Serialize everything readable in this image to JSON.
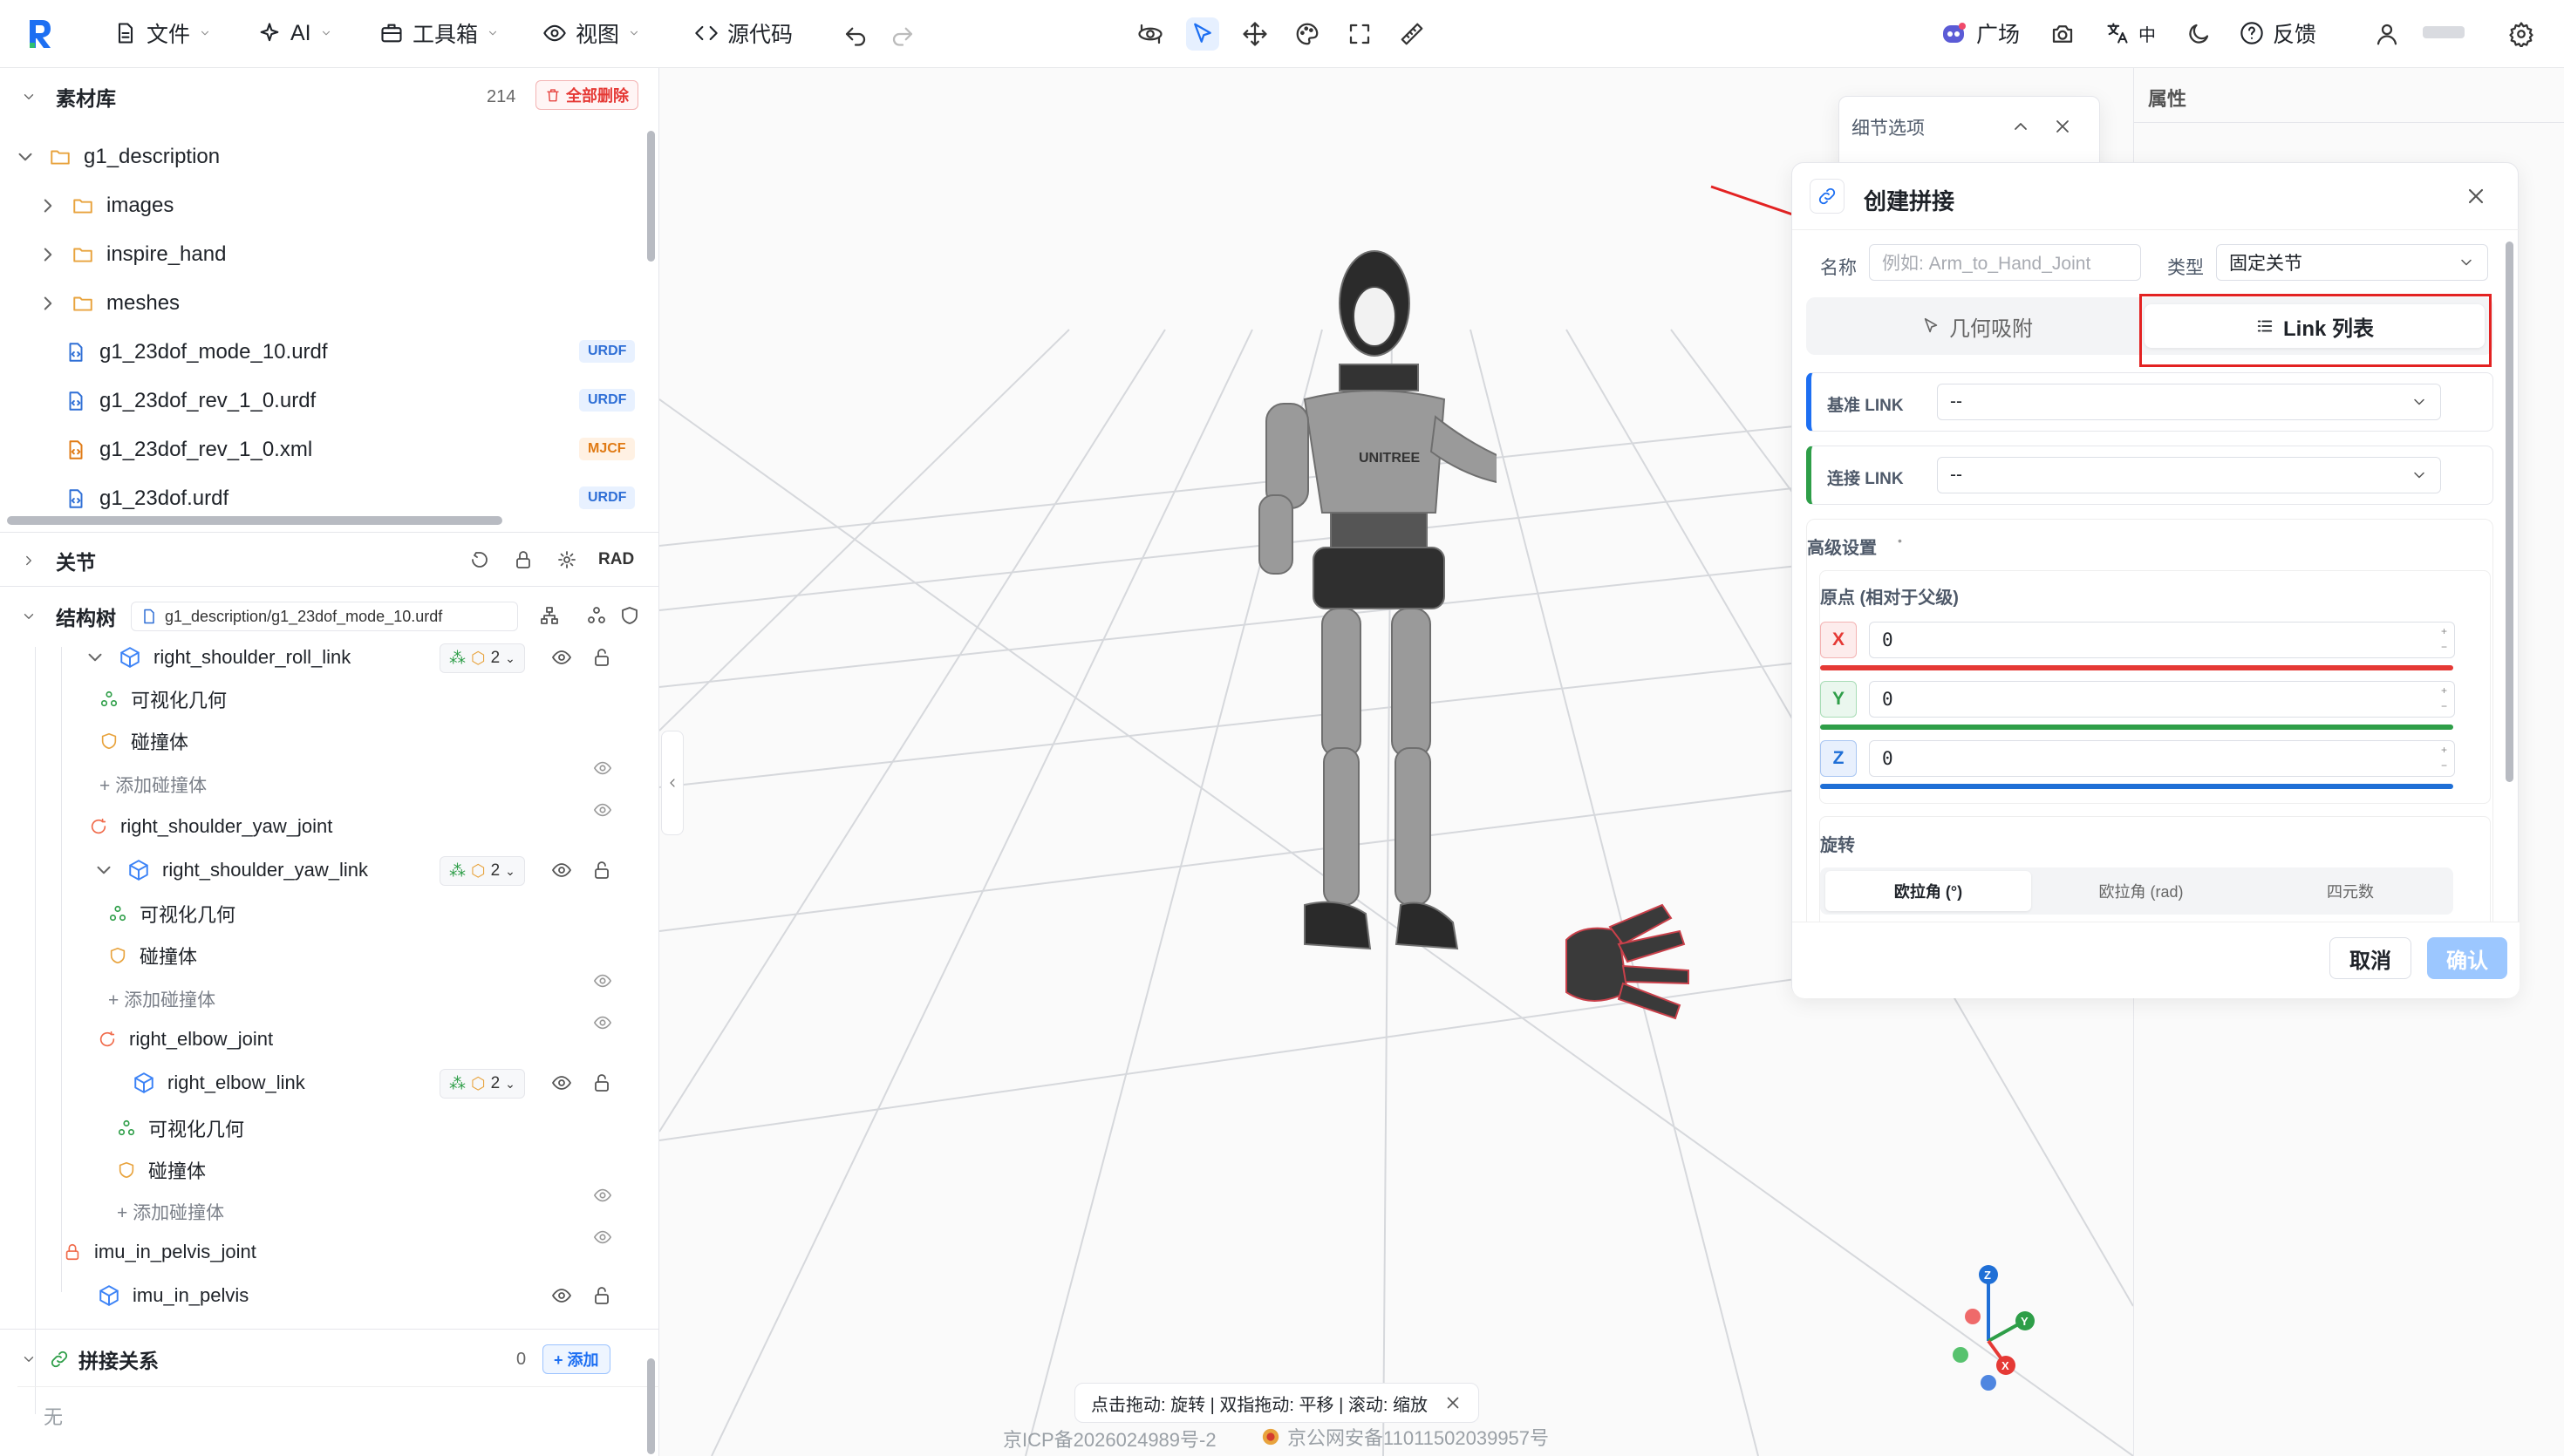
{
  "toolbar": {
    "menus": {
      "file": "文件",
      "ai": "AI",
      "toolbox": "工具箱",
      "view": "视图",
      "source": "源代码"
    },
    "right": {
      "plaza": "广场",
      "language": "中",
      "feedback": "反馈"
    }
  },
  "assets": {
    "title": "素材库",
    "count": "214",
    "delete_all": "全部删除",
    "root_folder": "g1_description",
    "folders": [
      "images",
      "inspire_hand",
      "meshes"
    ],
    "files": [
      {
        "name": "g1_23dof_mode_10.urdf",
        "badge": "URDF"
      },
      {
        "name": "g1_23dof_rev_1_0.urdf",
        "badge": "URDF"
      },
      {
        "name": "g1_23dof_rev_1_0.xml",
        "badge": "MJCF"
      },
      {
        "name": "g1_23dof.urdf",
        "badge": "URDF"
      }
    ]
  },
  "joints": {
    "title": "关节",
    "unit": "RAD"
  },
  "tree": {
    "title": "结构树",
    "file": "g1_description/g1_23dof_mode_10.urdf",
    "count": "2",
    "visual": "可视化几何",
    "collision": "碰撞体",
    "add_collision": "+ 添加碰撞体",
    "nodes": {
      "link1": "right_shoulder_roll_link",
      "joint2": "right_shoulder_yaw_joint",
      "link2": "right_shoulder_yaw_link",
      "joint3": "right_elbow_joint",
      "link3": "right_elbow_link",
      "joint4": "imu_in_pelvis_joint",
      "link4": "imu_in_pelvis"
    }
  },
  "splice": {
    "title": "拼接关系",
    "count": "0",
    "add": "+ 添加",
    "empty": "无"
  },
  "right_panel": {
    "title": "属性"
  },
  "detail_panel": {
    "title": "细节选项"
  },
  "dialog": {
    "title": "创建拼接",
    "name_label": "名称",
    "name_placeholder": "例如: Arm_to_Hand_Joint",
    "type_label": "类型",
    "type_value": "固定关节",
    "tab_geo": "几何吸附",
    "tab_link": "Link 列表",
    "base_link_label": "基准 LINK",
    "base_link_value": "--",
    "child_link_label": "连接 LINK",
    "child_link_value": "--",
    "advanced": "高级设置",
    "origin_title": "原点 (相对于父级)",
    "x_label": "X",
    "x_value": "0",
    "y_label": "Y",
    "y_value": "0",
    "z_label": "Z",
    "z_value": "0",
    "rotation": "旋转",
    "rot_tabs": [
      "欧拉角 (°)",
      "欧拉角 (rad)",
      "四元数"
    ],
    "cancel": "取消",
    "confirm": "确认"
  },
  "status": {
    "hint": "点击拖动: 旋转 | 双指拖动: 平移 | 滚动: 缩放"
  },
  "footer": {
    "icp": "京ICP备2026024989号-2",
    "police": "京公网安备11011502039957号"
  },
  "colors": {
    "accent": "#1d6ff2",
    "danger": "#e53935",
    "x_axis": "#e53935",
    "y_axis": "#2e9e48",
    "z_axis": "#1f6fd6"
  }
}
